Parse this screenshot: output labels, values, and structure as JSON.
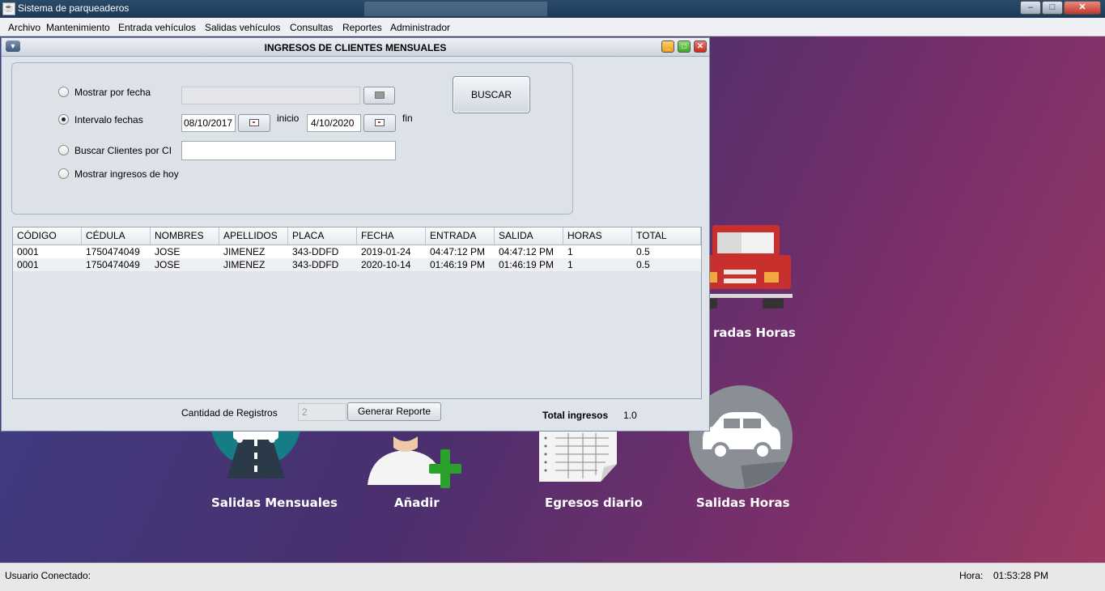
{
  "window": {
    "title": "Sistema de parqueaderos",
    "min": "‒",
    "max": "□",
    "close": "✕"
  },
  "menu": [
    "Archivo",
    "Mantenimiento",
    "Entrada vehículos",
    "Salidas vehículos",
    "Consultas",
    "Reportes",
    "Administrador"
  ],
  "desktop": {
    "labels": {
      "entradas_horas": "radas Horas",
      "salidas_mensuales": "Salidas Mensuales",
      "anadir": "Añadir",
      "egresos_diario": "Egresos diario",
      "salidas_horas": "Salidas Horas"
    },
    "colors": {
      "truck": "#c8302e",
      "teal": "#167c86",
      "green_plus": "#2aa12a",
      "gray_circle": "#8a8f96"
    }
  },
  "dialog": {
    "title": "INGRESOS DE CLIENTES MENSUALES",
    "options": {
      "por_fecha": "Mostrar por fecha",
      "intervalo": "Intervalo fechas",
      "por_ci": "Buscar Clientes por CI",
      "hoy": "Mostrar ingresos de hoy"
    },
    "selected_option": "intervalo",
    "date_inicio_value": "08/10/2017",
    "date_inicio_label": "inicio",
    "date_fin_value": "4/10/2020",
    "date_fin_label": "fin",
    "ci_value": "",
    "search_button": "BUSCAR",
    "table": {
      "columns": [
        "CÓDIGO",
        "CÉDULA",
        "NOMBRES",
        "APELLIDOS",
        "PLACA",
        "FECHA",
        "ENTRADA",
        "SALIDA",
        "HORAS",
        "TOTAL"
      ],
      "rows": [
        [
          "0001",
          "1750474049",
          "JOSE",
          "JIMENEZ",
          "343-DDFD",
          "2019-01-24",
          "04:47:12 PM",
          "04:47:12 PM",
          "1",
          "0.5"
        ],
        [
          "0001",
          "1750474049",
          "JOSE",
          "JIMENEZ",
          "343-DDFD",
          "2020-10-14",
          "01:46:19 PM",
          "01:46:19 PM",
          "1",
          "0.5"
        ]
      ]
    },
    "cantidad_label": "Cantidad de Registros",
    "cantidad_value": "2",
    "report_button": "Generar Reporte",
    "total_label": "Total ingresos",
    "total_value": "1.0"
  },
  "status": {
    "usuario_label": "Usuario Conectado:",
    "hora_label": "Hora:",
    "hora_value": "01:53:28 PM"
  }
}
